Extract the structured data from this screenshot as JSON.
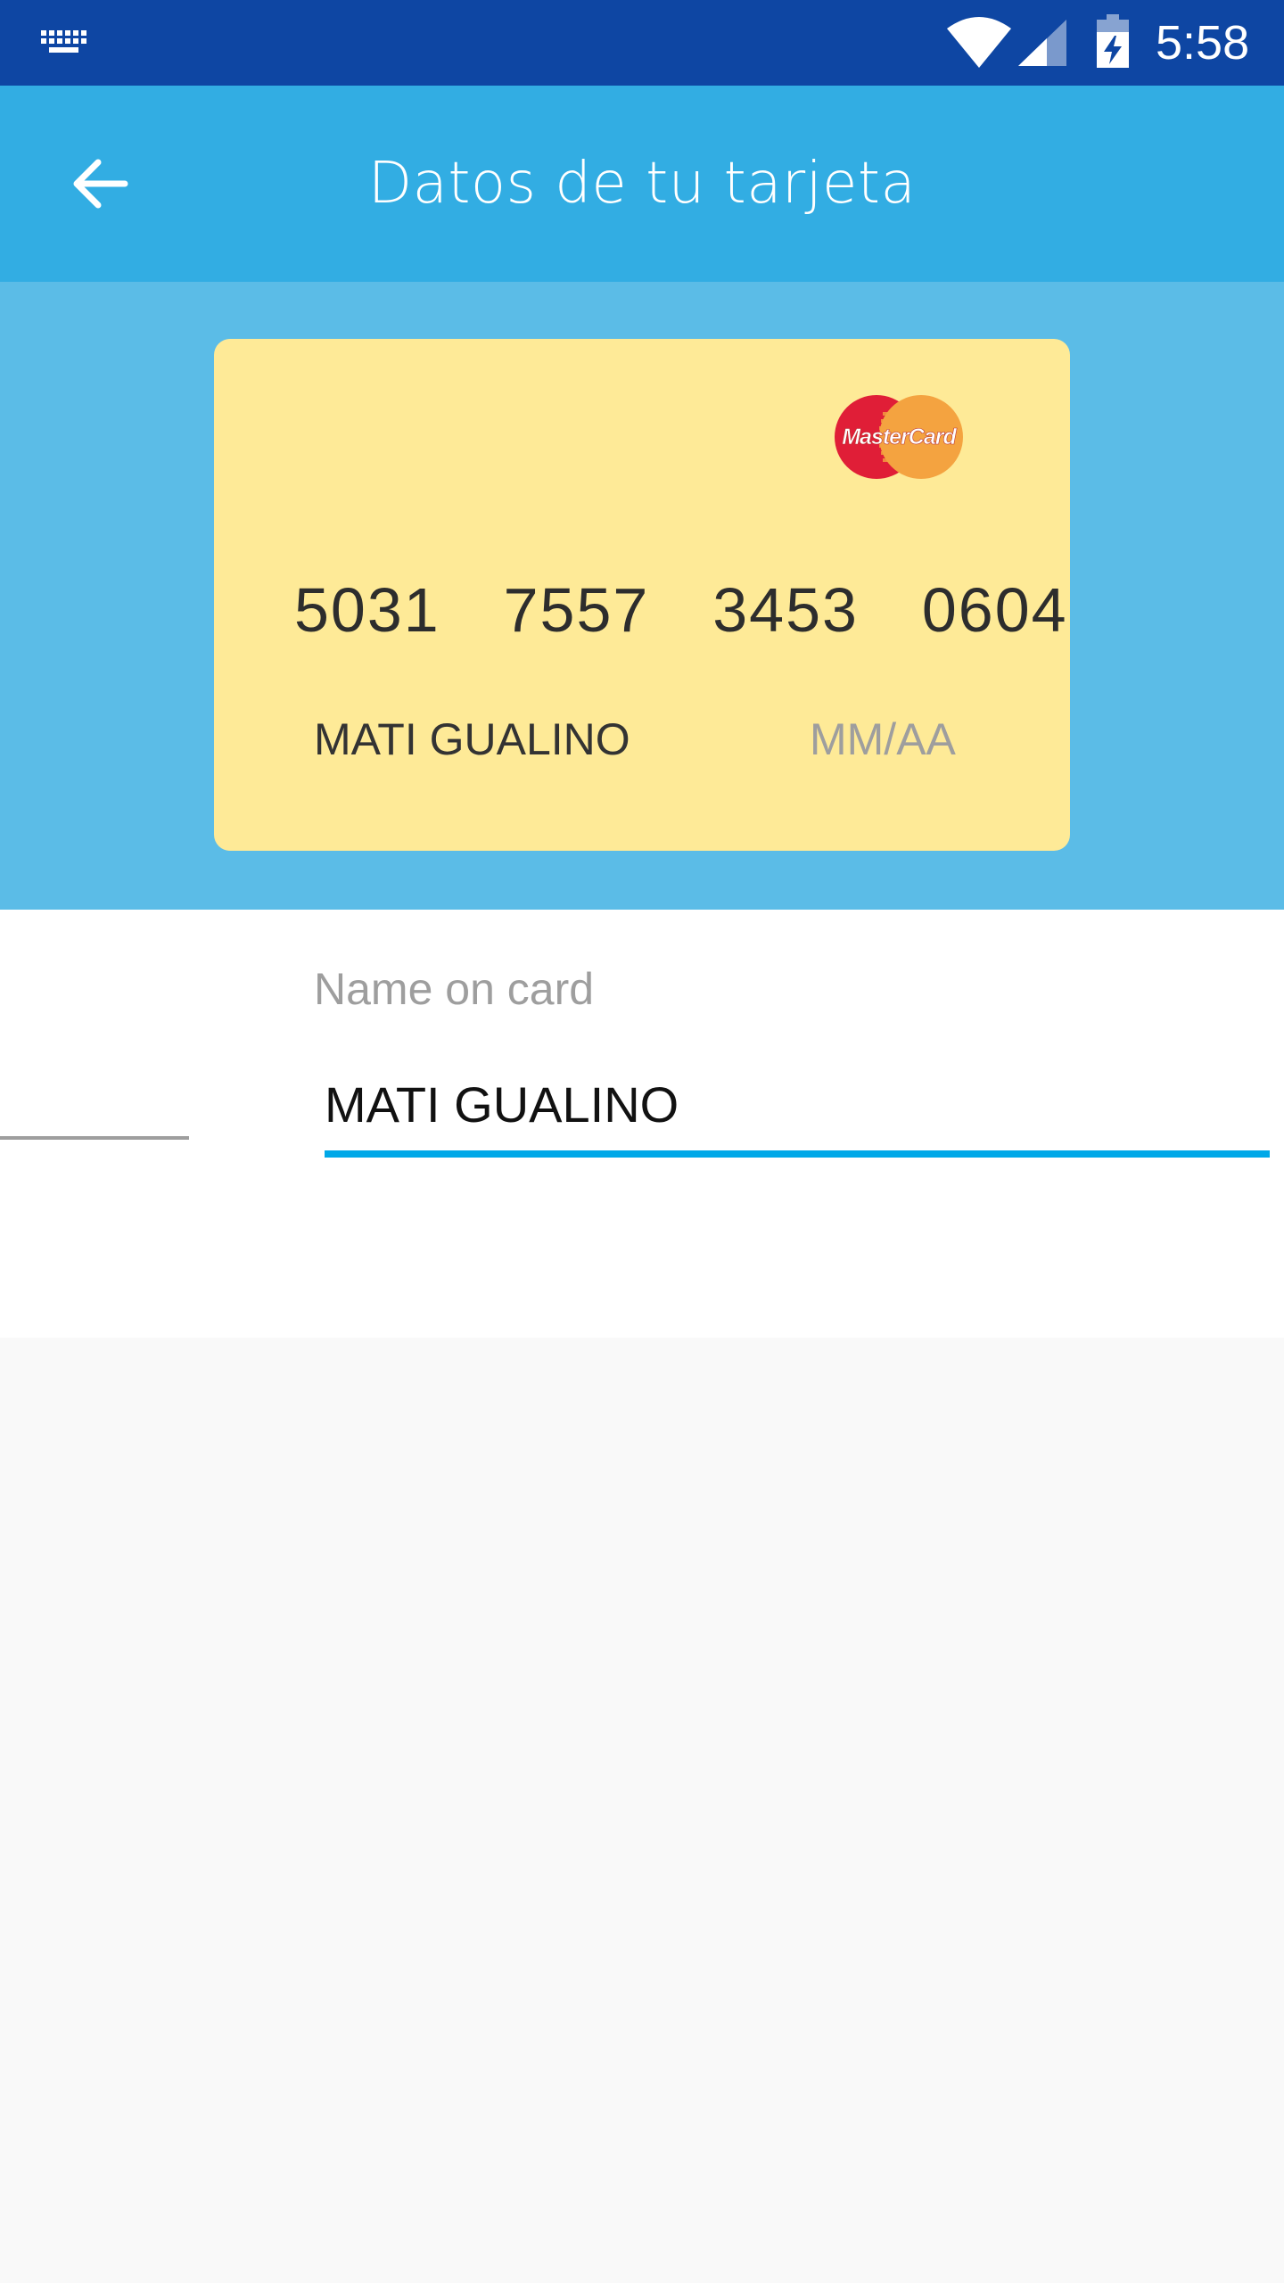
{
  "status_bar": {
    "time": "5:58",
    "icons": [
      "keyboard-icon",
      "wifi-icon",
      "signal-icon",
      "battery-charging-icon"
    ]
  },
  "app_bar": {
    "title": "Datos de tu tarjeta",
    "back_icon": "arrow-back-icon"
  },
  "card": {
    "brand": "MasterCard",
    "number": "5031  7557  3453  0604",
    "holder": "MATI GUALINO",
    "expiry": "MM/AA"
  },
  "form": {
    "name_label": "Name on card",
    "name_value": "MATI GUALINO"
  },
  "colors": {
    "status_bar": "#0e46a3",
    "app_bar": "#32ade3",
    "card_area": "#5bbce7",
    "card": "#feea97",
    "accent": "#00a8e8"
  }
}
